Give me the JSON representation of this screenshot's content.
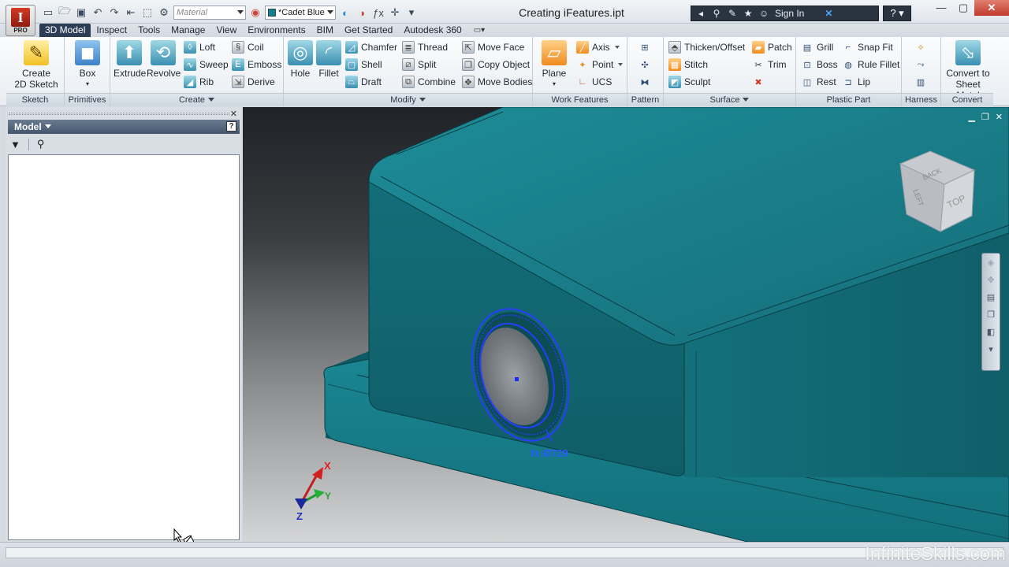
{
  "window": {
    "title": "Creating iFeatures.ipt",
    "app_logo_letter": "I",
    "app_badge": "PRO",
    "minimize": "—",
    "maximize": "▢",
    "close": "✕"
  },
  "quick_access": {
    "material_placeholder": "Material",
    "appearance_value": "*Cadet Blue",
    "fx": "ƒx"
  },
  "infocenter": {
    "sign_in": "Sign In",
    "help": "?"
  },
  "tabs": [
    "3D Model",
    "Inspect",
    "Tools",
    "Manage",
    "View",
    "Environments",
    "BIM",
    "Get Started",
    "Autodesk 360"
  ],
  "ribbon": {
    "sketch": {
      "label": "Sketch",
      "create_2d_sketch_line1": "Create",
      "create_2d_sketch_line2": "2D Sketch"
    },
    "primitives": {
      "label": "Primitives",
      "box": "Box"
    },
    "create": {
      "label": "Create",
      "extrude": "Extrude",
      "revolve": "Revolve",
      "loft": "Loft",
      "sweep": "Sweep",
      "rib": "Rib",
      "coil": "Coil",
      "emboss": "Emboss",
      "derive": "Derive"
    },
    "modify": {
      "label": "Modify",
      "hole": "Hole",
      "fillet": "Fillet",
      "chamfer": "Chamfer",
      "shell": "Shell",
      "draft": "Draft",
      "thread": "Thread",
      "split": "Split",
      "combine": "Combine",
      "move_face": "Move Face",
      "copy_object": "Copy Object",
      "move_bodies": "Move Bodies"
    },
    "work_features": {
      "label": "Work Features",
      "plane": "Plane",
      "axis": "Axis",
      "point": "Point",
      "ucs": "UCS"
    },
    "pattern": {
      "label": "Pattern"
    },
    "surface": {
      "label": "Surface",
      "thicken_offset": "Thicken/Offset",
      "stitch": "Stitch",
      "sculpt": "Sculpt",
      "patch": "Patch",
      "trim": "Trim"
    },
    "plastic_part": {
      "label": "Plastic Part",
      "grill": "Grill",
      "boss": "Boss",
      "rest": "Rest",
      "snap_fit": "Snap Fit",
      "rule_fillet": "Rule Fillet",
      "lip": "Lip"
    },
    "harness": {
      "label": "Harness"
    },
    "convert": {
      "label": "Convert",
      "convert_line1": "Convert to",
      "convert_line2": "Sheet Metal"
    }
  },
  "browser": {
    "title": "Model",
    "help": "?",
    "close": "✕"
  },
  "viewport": {
    "dimension_label": "fx:Ø729",
    "axis_x": "X",
    "axis_y": "Y",
    "axis_z": "Z",
    "viewcube_faces": {
      "top": "TOP",
      "left": "LEFT",
      "back": "BACK"
    }
  },
  "watermark": "InfiniteSkills.com",
  "colors": {
    "part_color": "#177f8c",
    "selection_blue": "#2a3cff",
    "active_tab": "#2c3e56"
  }
}
